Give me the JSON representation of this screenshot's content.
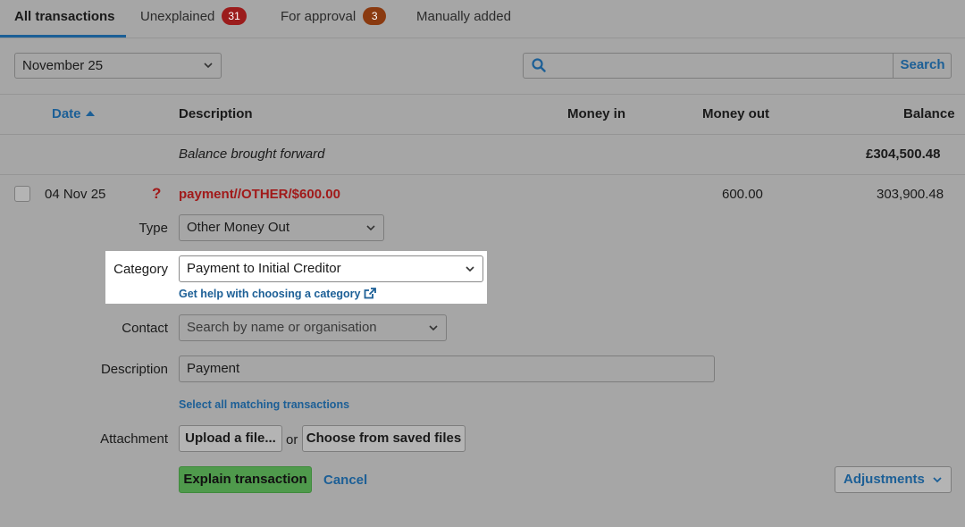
{
  "tabs": [
    {
      "label": "All transactions"
    },
    {
      "label": "Unexplained",
      "badge": "31",
      "badge_color": "#9b1c1c"
    },
    {
      "label": "For approval",
      "badge": "3",
      "badge_color": "#8a3a10"
    },
    {
      "label": "Manually added"
    }
  ],
  "filters": {
    "month_select": "November 25",
    "search_value": "",
    "search_button": "Search"
  },
  "table": {
    "columns": [
      "Date",
      "Description",
      "Money in",
      "Money out",
      "Balance"
    ],
    "sort_column": "Date",
    "balance_forward": {
      "description": "Balance brought forward",
      "balance": "£304,500.48"
    },
    "row": {
      "date": "04 Nov 25",
      "status": "?",
      "description": "payment//OTHER/$600.00",
      "money_out": "600.00",
      "balance": "303,900.48"
    }
  },
  "form": {
    "type_label": "Type",
    "type_value": "Other Money Out",
    "category_label": "Category",
    "category_value": "Payment to Initial Creditor",
    "category_help_link": "Get help with choosing a category",
    "contact_label": "Contact",
    "contact_placeholder": "Search by name or organisation",
    "description_label": "Description",
    "description_value": "Payment",
    "select_matching_link": "Select all matching transactions",
    "attachment_label": "Attachment",
    "upload_button": "Upload a file...",
    "or_text": "or",
    "choose_saved_button": "Choose from saved files",
    "explain_button": "Explain transaction",
    "cancel_link": "Cancel",
    "adjustments_button": "Adjustments"
  },
  "colors": {
    "accent_blue": "#1c5f96",
    "error_red": "#a11a1a",
    "primary_green": "#4f9a4c",
    "highlight_white": "#ffffff"
  }
}
